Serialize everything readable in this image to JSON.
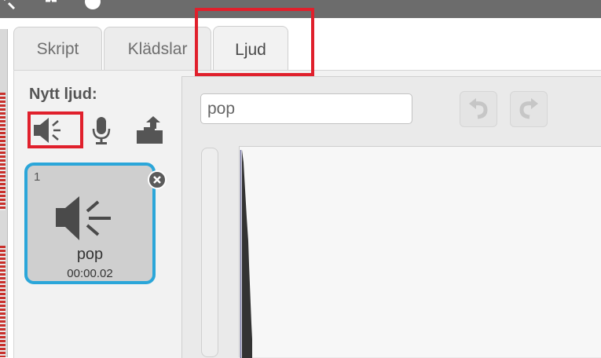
{
  "tabs": [
    {
      "label": "Skript",
      "active": false
    },
    {
      "label": "Klädslar",
      "active": false
    },
    {
      "label": "Ljud",
      "active": true
    }
  ],
  "new_sound": {
    "label": "Nytt ljud:",
    "buttons": [
      "speaker-library-icon",
      "microphone-icon",
      "upload-icon"
    ]
  },
  "sounds": [
    {
      "number": "1",
      "name": "pop",
      "duration": "00:00.02",
      "selected": true
    }
  ],
  "editor": {
    "name_value": "pop",
    "undo_icon": "undo-icon",
    "redo_icon": "redo-icon"
  },
  "colors": {
    "selected_border": "#2ba6d9",
    "annotation": "#e0202c",
    "waveform": "#333333"
  }
}
